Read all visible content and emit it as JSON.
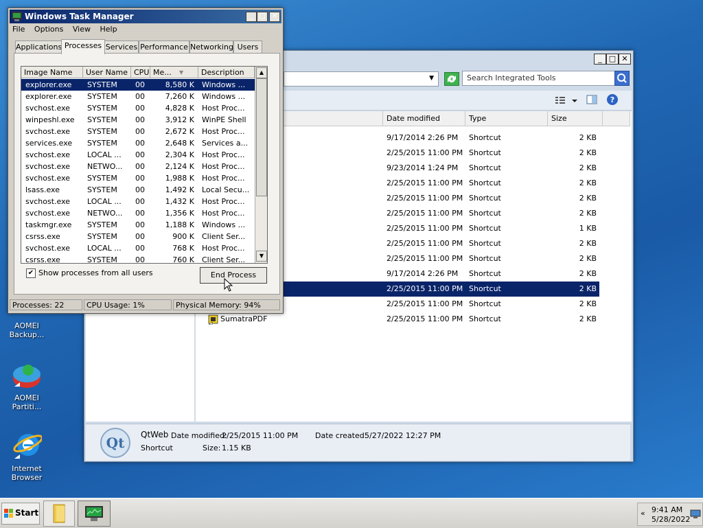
{
  "desktop": {
    "icons": [
      {
        "label_line1": "AOMEI",
        "label_line2": "Backup..."
      },
      {
        "label_line1": "AOMEI",
        "label_line2": "Partiti..."
      },
      {
        "label_line1": "Internet",
        "label_line2": "Browser"
      }
    ]
  },
  "explorer": {
    "search_placeholder": "Search Integrated Tools",
    "columns": [
      "Date modified",
      "Type",
      "Size"
    ],
    "rows": [
      {
        "name": "",
        "date": "9/17/2014 2:26 PM",
        "type": "Shortcut",
        "size": "2 KB"
      },
      {
        "name": "",
        "date": "2/25/2015 11:00 PM",
        "type": "Shortcut",
        "size": "2 KB"
      },
      {
        "name": "",
        "date": "9/23/2014 1:24 PM",
        "type": "Shortcut",
        "size": "2 KB"
      },
      {
        "name": "",
        "date": "2/25/2015 11:00 PM",
        "type": "Shortcut",
        "size": "2 KB"
      },
      {
        "name": "",
        "date": "2/25/2015 11:00 PM",
        "type": "Shortcut",
        "size": "2 KB"
      },
      {
        "name": "",
        "date": "2/25/2015 11:00 PM",
        "type": "Shortcut",
        "size": "2 KB"
      },
      {
        "name": "",
        "date": "2/25/2015 11:00 PM",
        "type": "Shortcut",
        "size": "1 KB"
      },
      {
        "name": "",
        "date": "2/25/2015 11:00 PM",
        "type": "Shortcut",
        "size": "2 KB"
      },
      {
        "name": "",
        "date": "2/25/2015 11:00 PM",
        "type": "Shortcut",
        "size": "2 KB"
      },
      {
        "name": "",
        "date": "9/17/2014 2:26 PM",
        "type": "Shortcut",
        "size": "2 KB"
      },
      {
        "name": "",
        "date": "2/25/2015 11:00 PM",
        "type": "Shortcut",
        "size": "2 KB"
      },
      {
        "name": "",
        "date": "2/25/2015 11:00 PM",
        "type": "Shortcut",
        "size": "2 KB"
      },
      {
        "name": "SumatraPDF",
        "date": "2/25/2015 11:00 PM",
        "type": "Shortcut",
        "size": "2 KB"
      }
    ],
    "details": {
      "name": "QtWeb",
      "kind": "Shortcut",
      "date_modified_label": "Date modified:",
      "date_modified": "2/25/2015 11:00 PM",
      "date_created_label": "Date created:",
      "date_created": "5/27/2022 12:27 PM",
      "size_label": "Size:",
      "size": "1.15 KB",
      "logo_text": "Qt"
    }
  },
  "taskmgr": {
    "title": "Windows Task Manager",
    "menu": [
      "File",
      "Options",
      "View",
      "Help"
    ],
    "tabs": [
      "Applications",
      "Processes",
      "Services",
      "Performance",
      "Networking",
      "Users"
    ],
    "columns": [
      "Image Name",
      "User Name",
      "CPU",
      "Me...",
      "Description"
    ],
    "processes": [
      {
        "image": "explorer.exe",
        "user": "SYSTEM",
        "cpu": "00",
        "mem": "8,580 K",
        "desc": "Windows ..."
      },
      {
        "image": "explorer.exe",
        "user": "SYSTEM",
        "cpu": "00",
        "mem": "7,260 K",
        "desc": "Windows ..."
      },
      {
        "image": "svchost.exe",
        "user": "SYSTEM",
        "cpu": "00",
        "mem": "4,828 K",
        "desc": "Host Proc..."
      },
      {
        "image": "winpeshl.exe",
        "user": "SYSTEM",
        "cpu": "00",
        "mem": "3,912 K",
        "desc": "WinPE Shell"
      },
      {
        "image": "svchost.exe",
        "user": "SYSTEM",
        "cpu": "00",
        "mem": "2,672 K",
        "desc": "Host Proc..."
      },
      {
        "image": "services.exe",
        "user": "SYSTEM",
        "cpu": "00",
        "mem": "2,648 K",
        "desc": "Services a..."
      },
      {
        "image": "svchost.exe",
        "user": "LOCAL ...",
        "cpu": "00",
        "mem": "2,304 K",
        "desc": "Host Proc..."
      },
      {
        "image": "svchost.exe",
        "user": "NETWO...",
        "cpu": "00",
        "mem": "2,124 K",
        "desc": "Host Proc..."
      },
      {
        "image": "svchost.exe",
        "user": "SYSTEM",
        "cpu": "00",
        "mem": "1,988 K",
        "desc": "Host Proc..."
      },
      {
        "image": "lsass.exe",
        "user": "SYSTEM",
        "cpu": "00",
        "mem": "1,492 K",
        "desc": "Local Secu..."
      },
      {
        "image": "svchost.exe",
        "user": "LOCAL ...",
        "cpu": "00",
        "mem": "1,432 K",
        "desc": "Host Proc..."
      },
      {
        "image": "svchost.exe",
        "user": "NETWO...",
        "cpu": "00",
        "mem": "1,356 K",
        "desc": "Host Proc..."
      },
      {
        "image": "taskmgr.exe",
        "user": "SYSTEM",
        "cpu": "00",
        "mem": "1,188 K",
        "desc": "Windows ..."
      },
      {
        "image": "csrss.exe",
        "user": "SYSTEM",
        "cpu": "00",
        "mem": "900 K",
        "desc": "Client Ser..."
      },
      {
        "image": "svchost.exe",
        "user": "LOCAL ...",
        "cpu": "00",
        "mem": "768 K",
        "desc": "Host Proc..."
      },
      {
        "image": "csrss.exe",
        "user": "SYSTEM",
        "cpu": "00",
        "mem": "760 K",
        "desc": "Client Ser..."
      }
    ],
    "show_all_label": "Show processes from all users",
    "show_all_checked": true,
    "end_process_label": "End Process",
    "status": {
      "processes": "Processes: 22",
      "cpu": "CPU Usage: 1%",
      "memory": "Physical Memory: 94%"
    }
  },
  "taskbar": {
    "start_label": "Start",
    "time": "9:41 AM",
    "date": "5/28/2022"
  },
  "colors": {
    "selection": "#0a246a",
    "titlebar": "#0a246a"
  }
}
